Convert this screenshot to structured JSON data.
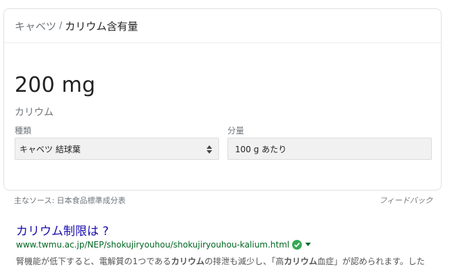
{
  "card": {
    "breadcrumb_link": "キャベツ",
    "breadcrumb_separator": "/",
    "breadcrumb_current": "カリウム含有量",
    "value": "200 mg",
    "nutrient": "カリウム",
    "type_label": "種類",
    "type_selected": "キャベツ 結球葉",
    "amount_label": "分量",
    "amount_selected": "100 g あたり"
  },
  "footer": {
    "source": "主なソース: 日本食品標準成分表",
    "feedback": "フィードバック"
  },
  "result": {
    "title": "カリウム制限は ?",
    "url": "www.twmu.ac.jp/NEP/shokujiryouhou/shokujiryouhou-kalium.html",
    "snippet_1": "腎機能が低下すると、電解質の1つである",
    "snippet_2": "カリウム",
    "snippet_3": "の排泄も減少し、「高",
    "snippet_4": "カリウム",
    "snippet_5": "血症」が認められます。した",
    "colors": {
      "title": "#1a0dab",
      "url": "#006621",
      "verified": "#34a853"
    }
  }
}
